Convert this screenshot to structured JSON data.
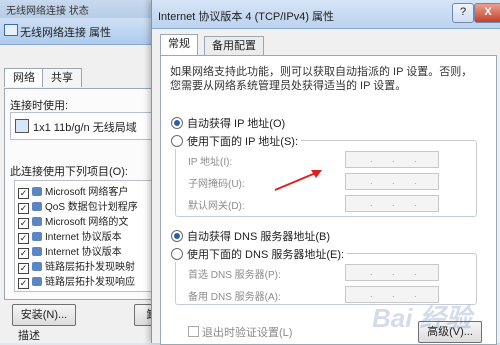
{
  "background_window": {
    "top_partial_title": "无线网络连接 状态",
    "title": "无线网络连接 属性",
    "tabs": [
      "网络",
      "共享"
    ],
    "connect_using_label": "连接时使用:",
    "adapter_name": "1x1 11b/g/n 无线局域",
    "items_label": "此连接使用下列项目(O):",
    "items": [
      {
        "label": "Microsoft 网络客户",
        "checked": true
      },
      {
        "label": "QoS 数据包计划程序",
        "checked": true
      },
      {
        "label": "Microsoft 网络的文",
        "checked": true
      },
      {
        "label": "Internet 协议版本",
        "checked": true
      },
      {
        "label": "Internet 协议版本",
        "checked": true
      },
      {
        "label": "链路层拓扑发现映射",
        "checked": true
      },
      {
        "label": "链路层拓扑发现响应",
        "checked": true
      }
    ],
    "install_button": "安装(N)...",
    "uninstall_partial": "卸",
    "description_label": "描述"
  },
  "dialog": {
    "title": "Internet 协议版本 4 (TCP/IPv4) 属性",
    "help_glyph": "?",
    "close_glyph": "X",
    "tabs": [
      "常规",
      "备用配置"
    ],
    "description": "如果网络支持此功能，则可以获取自动指派的 IP 设置。否则，您需要从网络系统管理员处获得适当的 IP 设置。",
    "ip_auto_label": "自动获得 IP 地址(O)",
    "ip_manual_label": "使用下面的 IP 地址(S):",
    "ip_address_label": "IP 地址(I):",
    "subnet_label": "子网掩码(U):",
    "gateway_label": "默认网关(D):",
    "dns_auto_label": "自动获得 DNS 服务器地址(B)",
    "dns_manual_label": "使用下面的 DNS 服务器地址(E):",
    "preferred_dns_label": "首选 DNS 服务器(P):",
    "alternate_dns_label": "备用 DNS 服务器(A):",
    "validate_label": "退出时验证设置(L)",
    "advanced_button": "高级(V)..."
  },
  "watermark": "Bai 经验",
  "colors": {
    "arrow": "#e02020",
    "title_bar": "#bcd2ee"
  }
}
